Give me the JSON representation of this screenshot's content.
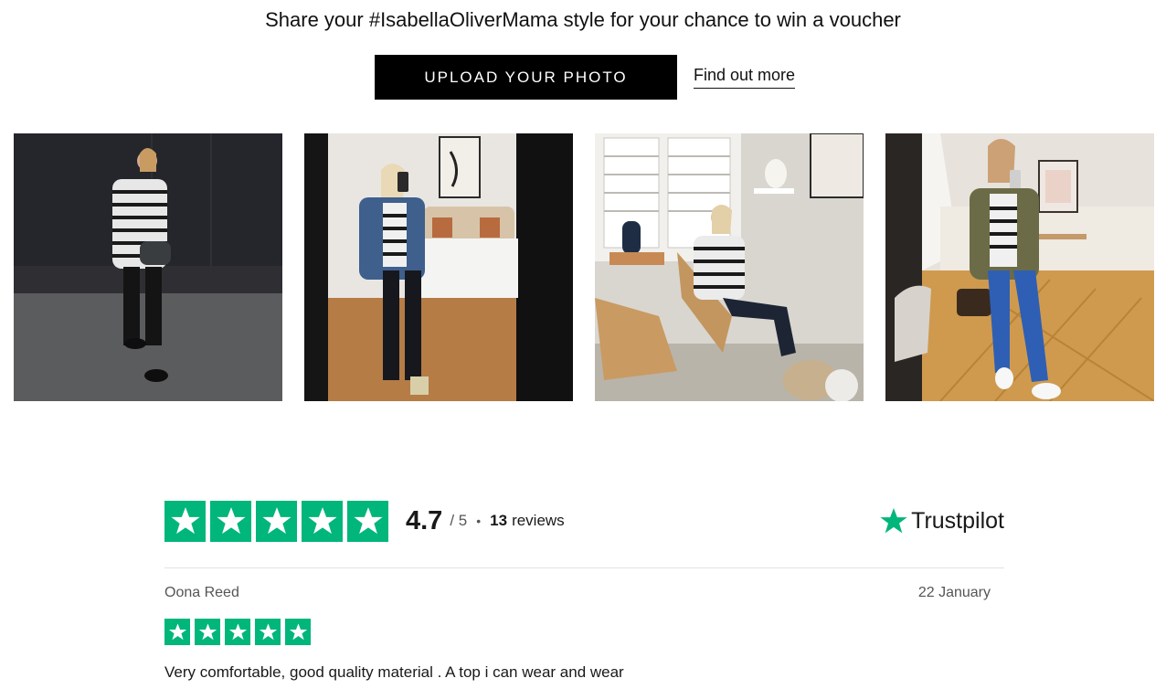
{
  "header": {
    "headline": "Share your #IsabellaOliverMama style for your chance to win a voucher",
    "upload_button": "UPLOAD YOUR PHOTO",
    "find_out_link": "Find out more"
  },
  "gallery": {
    "photos": [
      {
        "name": "photo-1"
      },
      {
        "name": "photo-2"
      },
      {
        "name": "photo-3"
      },
      {
        "name": "photo-4"
      }
    ]
  },
  "trustpilot": {
    "score": "4.7",
    "out_of": "/ 5",
    "separator": "•",
    "review_count": "13",
    "reviews_label": "reviews",
    "logo_text": "Trustpilot",
    "rating_stars": 5,
    "star_color": "#00b67a"
  },
  "review": {
    "author": "Oona Reed",
    "date": "22 January",
    "stars": 5,
    "text": "Very comfortable, good quality material . A top i can wear and wear"
  }
}
